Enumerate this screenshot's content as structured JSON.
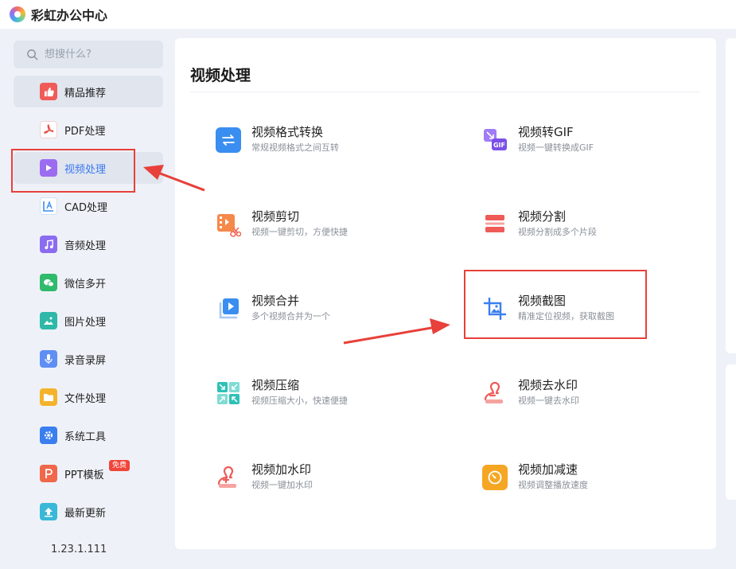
{
  "app": {
    "title": "彩虹办公中心"
  },
  "search": {
    "placeholder": "想搜什么?"
  },
  "sidebar": {
    "items": [
      {
        "label": "精品推荐",
        "icon": "thumbs-up-icon",
        "color": "#ef5b57"
      },
      {
        "label": "PDF处理",
        "icon": "pdf-icon",
        "color": "#ef5b57"
      },
      {
        "label": "视频处理",
        "icon": "play-icon",
        "color": "#9b6cf0"
      },
      {
        "label": "CAD处理",
        "icon": "cad-icon",
        "color": "#3a8ef0"
      },
      {
        "label": "音频处理",
        "icon": "music-icon",
        "color": "#8b6cf0"
      },
      {
        "label": "微信多开",
        "icon": "wechat-icon",
        "color": "#2fba6c"
      },
      {
        "label": "图片处理",
        "icon": "image-icon",
        "color": "#2fb8a8"
      },
      {
        "label": "录音录屏",
        "icon": "microphone-icon",
        "color": "#5f8ef5"
      },
      {
        "label": "文件处理",
        "icon": "folder-icon",
        "color": "#f5b32c"
      },
      {
        "label": "系统工具",
        "icon": "gear-icon",
        "color": "#3a7ef0"
      },
      {
        "label": "PPT模板",
        "icon": "ppt-icon",
        "color": "#f0674a",
        "badge": "免费"
      },
      {
        "label": "最新更新",
        "icon": "upload-icon",
        "color": "#3ab8d8"
      }
    ],
    "version": "1.23.1.111"
  },
  "main": {
    "title": "视频处理",
    "tools": [
      {
        "name": "视频格式转换",
        "desc": "常规视频格式之间互转",
        "icon": "swap-arrows-icon",
        "color": "#3a8ef0"
      },
      {
        "name": "视频转GIF",
        "desc": "视频一键转换成GIF",
        "icon": "gif-icon",
        "color": "#8b5cf0"
      },
      {
        "name": "视频剪切",
        "desc": "视频一键剪切，方便快捷",
        "icon": "film-scissors-icon",
        "color": "#f08a4a"
      },
      {
        "name": "视频分割",
        "desc": "视频分割成多个片段",
        "icon": "split-bars-icon",
        "color": "#ef5b57"
      },
      {
        "name": "视频合并",
        "desc": "多个视频合并为一个",
        "icon": "merge-play-icon",
        "color": "#3a8ef0"
      },
      {
        "name": "视频截图",
        "desc": "精准定位视频，获取截图",
        "icon": "crop-image-icon",
        "color": "#3a7ef0"
      },
      {
        "name": "视频压缩",
        "desc": "视频压缩大小，快速便捷",
        "icon": "compress-arrows-icon",
        "color": "#2fc1b6"
      },
      {
        "name": "视频去水印",
        "desc": "视频一键去水印",
        "icon": "stamp-remove-icon",
        "color": "#ef5b57"
      },
      {
        "name": "视频加水印",
        "desc": "视频一键加水印",
        "icon": "stamp-add-icon",
        "color": "#ef5b57"
      },
      {
        "name": "视频加减速",
        "desc": "视频调整播放速度",
        "icon": "speed-dial-icon",
        "color": "#f5a623"
      }
    ]
  },
  "annotations": {
    "highlight_color": "#e8403a"
  }
}
